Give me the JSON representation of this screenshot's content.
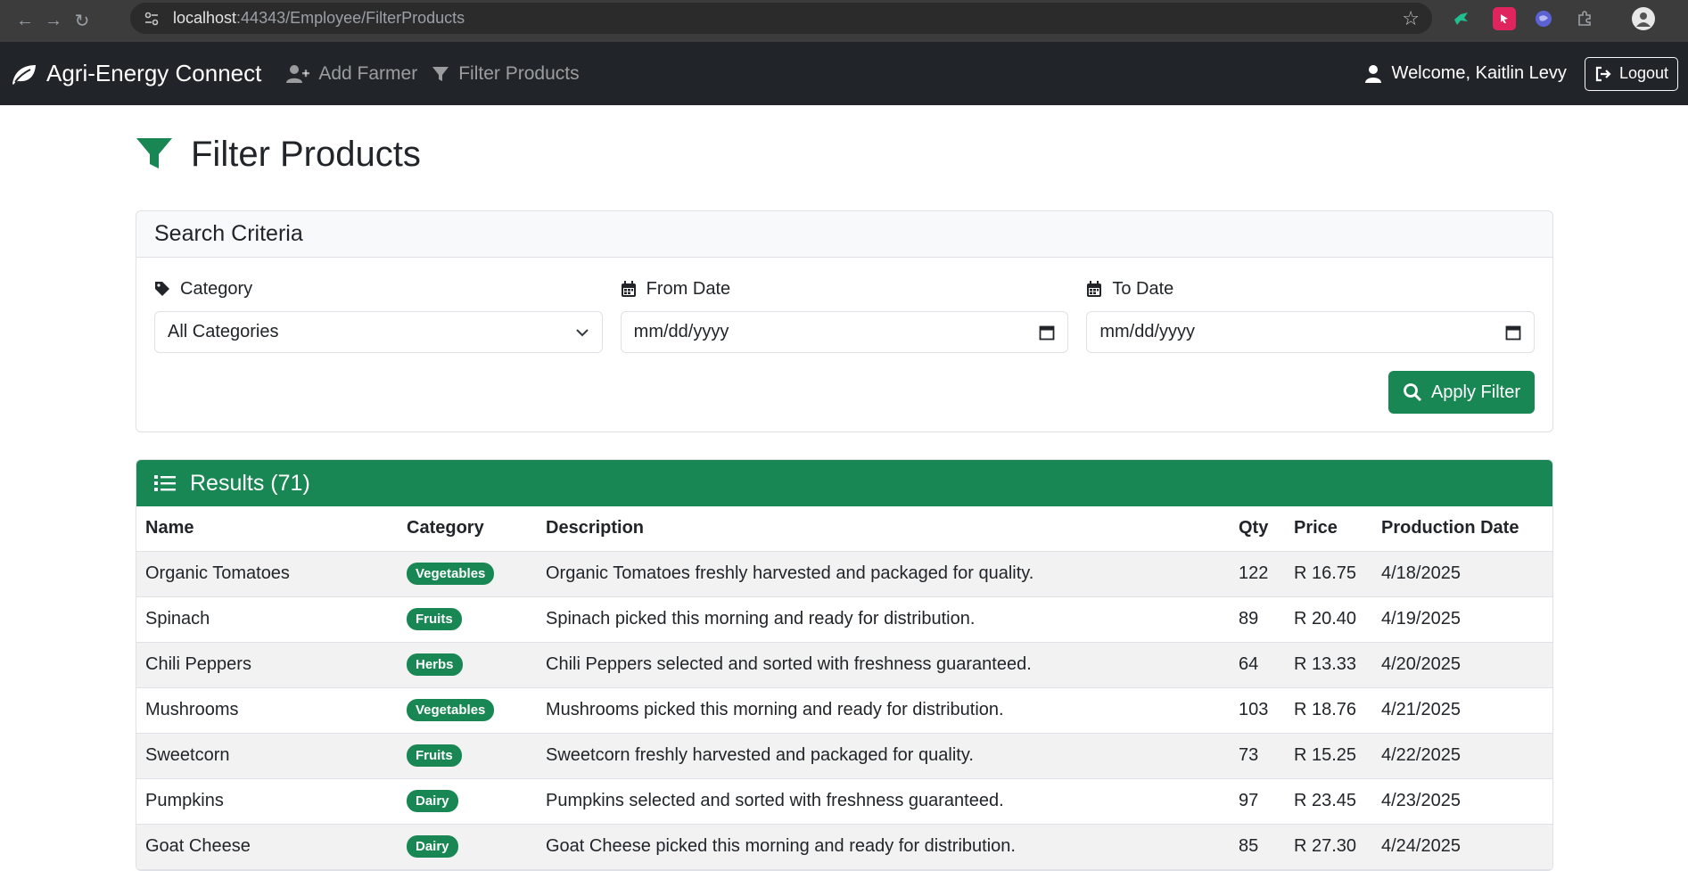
{
  "browser": {
    "url_host": "localhost",
    "url_rest": ":44343/Employee/FilterProducts"
  },
  "navbar": {
    "brand": "Agri-Energy Connect",
    "links": [
      {
        "label": "Add Farmer",
        "icon": "user-plus-icon"
      },
      {
        "label": "Filter Products",
        "icon": "filter-icon"
      }
    ],
    "welcome": "Welcome, Kaitlin Levy",
    "logout": "Logout"
  },
  "page": {
    "title": "Filter Products"
  },
  "search": {
    "header": "Search Criteria",
    "category_label": "Category",
    "category_value": "All Categories",
    "from_label": "From Date",
    "from_value": "mm/dd/yyyy",
    "to_label": "To Date",
    "to_value": "mm/dd/yyyy",
    "apply": "Apply Filter"
  },
  "results": {
    "header": "Results (71)",
    "columns": [
      "Name",
      "Category",
      "Description",
      "Qty",
      "Price",
      "Production Date"
    ],
    "rows": [
      {
        "name": "Organic Tomatoes",
        "category": "Vegetables",
        "description": "Organic Tomatoes freshly harvested and packaged for quality.",
        "qty": "122",
        "price": "R 16.75",
        "date": "4/18/2025"
      },
      {
        "name": "Spinach",
        "category": "Fruits",
        "description": "Spinach picked this morning and ready for distribution.",
        "qty": "89",
        "price": "R 20.40",
        "date": "4/19/2025"
      },
      {
        "name": "Chili Peppers",
        "category": "Herbs",
        "description": "Chili Peppers selected and sorted with freshness guaranteed.",
        "qty": "64",
        "price": "R 13.33",
        "date": "4/20/2025"
      },
      {
        "name": "Mushrooms",
        "category": "Vegetables",
        "description": "Mushrooms picked this morning and ready for distribution.",
        "qty": "103",
        "price": "R 18.76",
        "date": "4/21/2025"
      },
      {
        "name": "Sweetcorn",
        "category": "Fruits",
        "description": "Sweetcorn freshly harvested and packaged for quality.",
        "qty": "73",
        "price": "R 15.25",
        "date": "4/22/2025"
      },
      {
        "name": "Pumpkins",
        "category": "Dairy",
        "description": "Pumpkins selected and sorted with freshness guaranteed.",
        "qty": "97",
        "price": "R 23.45",
        "date": "4/23/2025"
      },
      {
        "name": "Goat Cheese",
        "category": "Dairy",
        "description": "Goat Cheese picked this morning and ready for distribution.",
        "qty": "85",
        "price": "R 27.30",
        "date": "4/24/2025"
      }
    ]
  },
  "colors": {
    "accent": "#198754",
    "navbar": "#212529"
  }
}
